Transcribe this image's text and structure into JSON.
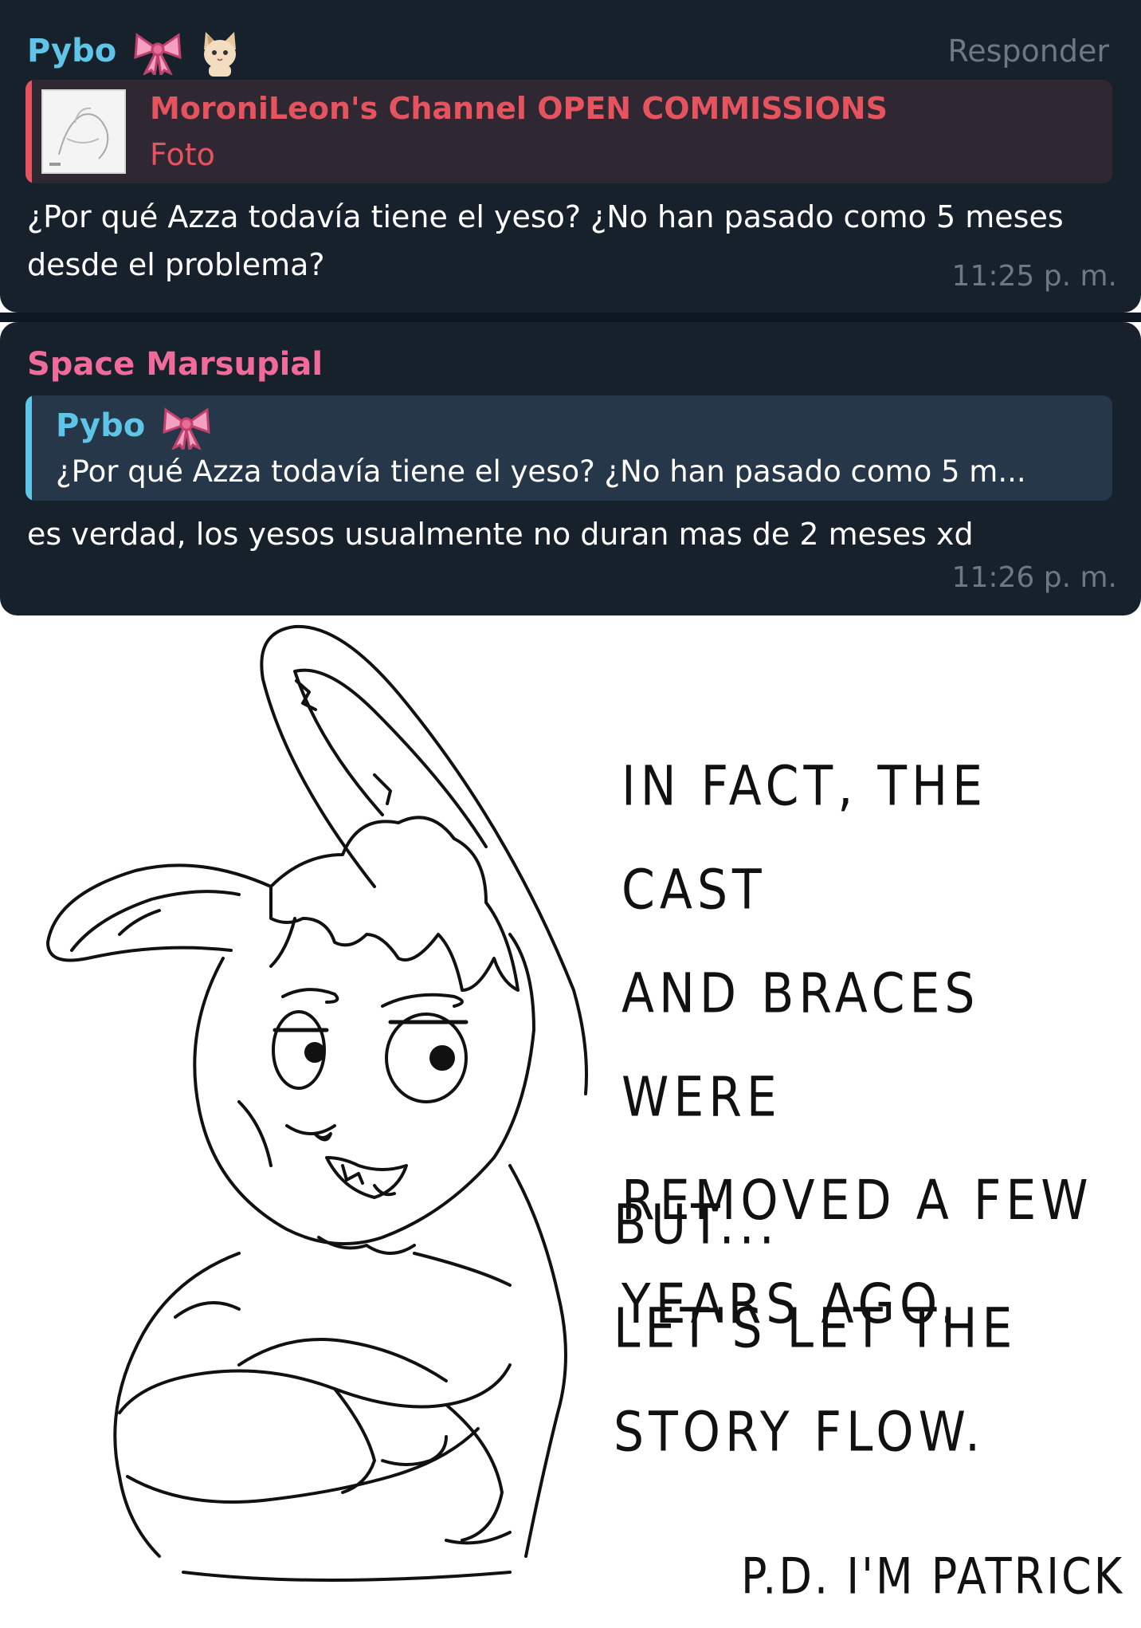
{
  "message1": {
    "sender": "Pybo",
    "sender_color": "#5fc5e8",
    "action": "Responder",
    "forwarded": {
      "title": "MoroniLeon's Channel OPEN COMMISSIONS",
      "subtitle": "Foto",
      "color": "#e5545e"
    },
    "text_line1": "¿Por qué Azza todavía tiene el yeso? ¿No han pasado como 5 meses",
    "text_line2": "desde el problema?",
    "time": "11:25 p. m."
  },
  "message2": {
    "sender": "Space Marsupial",
    "sender_color": "#f06b9a",
    "quote": {
      "sender": "Pybo",
      "text": "¿Por qué Azza todavía tiene el yeso? ¿No han pasado como 5 m...",
      "color": "#5fc5e8"
    },
    "text": "es verdad, los yesos usualmente no duran mas de 2 meses xd",
    "time": "11:26 p. m."
  },
  "comic": {
    "text1": "IN FACT, THE CAST\nAND BRACES WERE\nREMOVED A FEW\nYEARS AGO.",
    "text2": "BUT...\nLET'S LET THE\nSTORY FLOW.",
    "signature": "P.D. I'M PATRICK"
  }
}
